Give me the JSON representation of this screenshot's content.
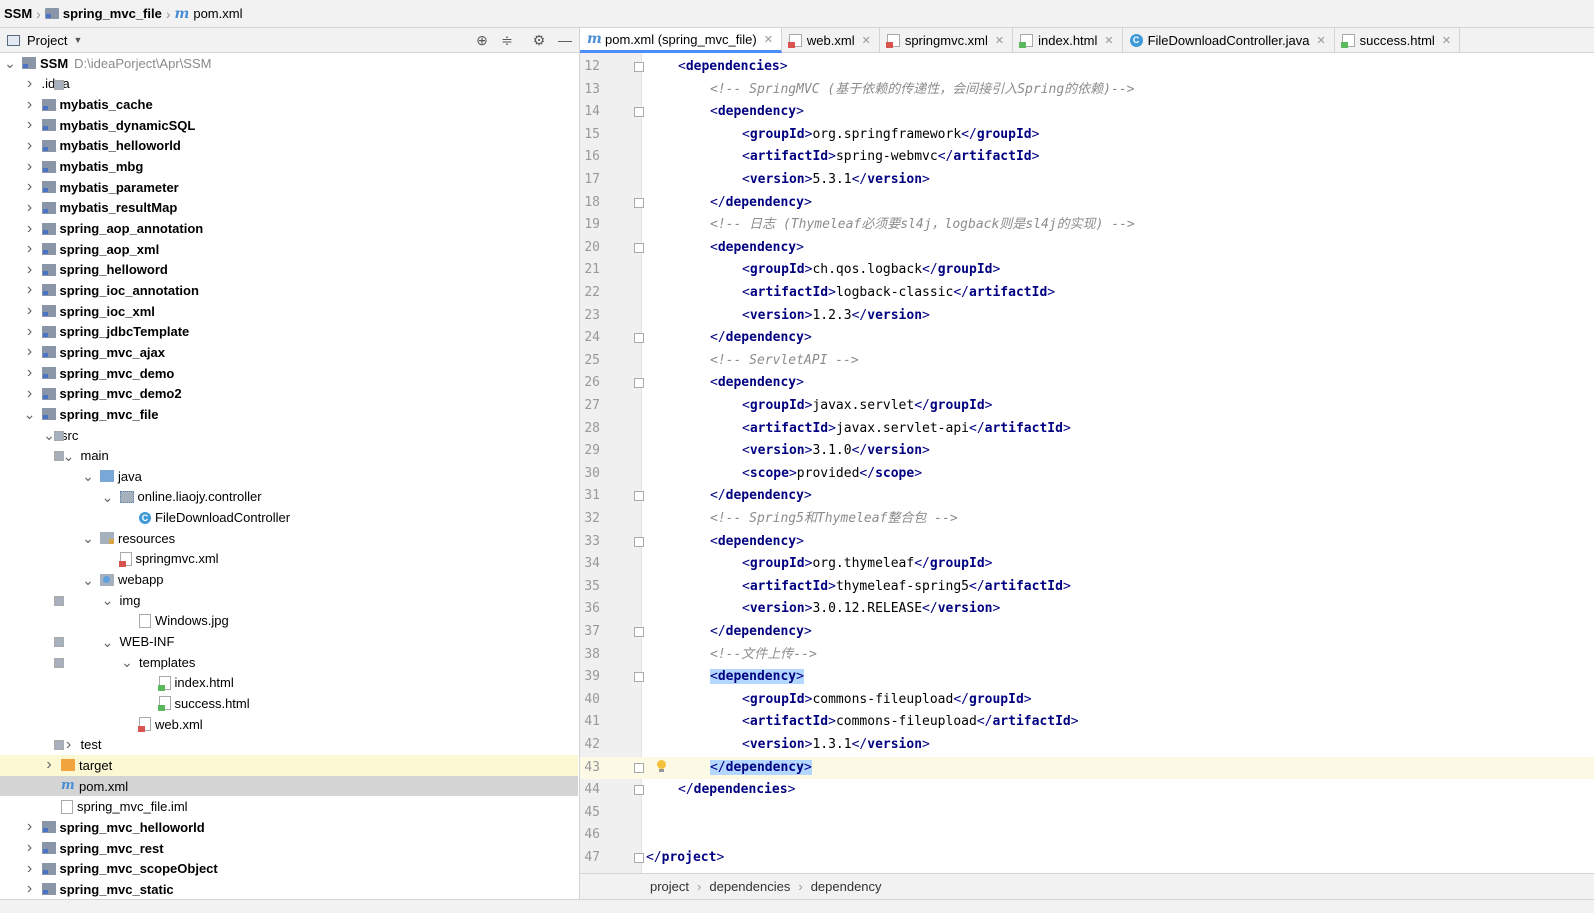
{
  "breadcrumb": {
    "items": [
      "SSM",
      "spring_mvc_file",
      "pom.xml"
    ]
  },
  "project_panel": {
    "title": "Project"
  },
  "tree": [
    {
      "depth": 0,
      "arrow": "open",
      "icon": "mod",
      "name": "SSM",
      "bold": true,
      "path": "D:\\ideaPorject\\Apr\\SSM"
    },
    {
      "depth": 1,
      "arrow": "closed",
      "icon": "fold",
      "name": ".idea",
      "bold": false
    },
    {
      "depth": 1,
      "arrow": "closed",
      "icon": "mod",
      "name": "mybatis_cache",
      "bold": true
    },
    {
      "depth": 1,
      "arrow": "closed",
      "icon": "mod",
      "name": "mybatis_dynamicSQL",
      "bold": true
    },
    {
      "depth": 1,
      "arrow": "closed",
      "icon": "mod",
      "name": "mybatis_helloworld",
      "bold": true
    },
    {
      "depth": 1,
      "arrow": "closed",
      "icon": "mod",
      "name": "mybatis_mbg",
      "bold": true
    },
    {
      "depth": 1,
      "arrow": "closed",
      "icon": "mod",
      "name": "mybatis_parameter",
      "bold": true
    },
    {
      "depth": 1,
      "arrow": "closed",
      "icon": "mod",
      "name": "mybatis_resultMap",
      "bold": true
    },
    {
      "depth": 1,
      "arrow": "closed",
      "icon": "mod",
      "name": "spring_aop_annotation",
      "bold": true
    },
    {
      "depth": 1,
      "arrow": "closed",
      "icon": "mod",
      "name": "spring_aop_xml",
      "bold": true
    },
    {
      "depth": 1,
      "arrow": "closed",
      "icon": "mod",
      "name": "spring_helloword",
      "bold": true
    },
    {
      "depth": 1,
      "arrow": "closed",
      "icon": "mod",
      "name": "spring_ioc_annotation",
      "bold": true
    },
    {
      "depth": 1,
      "arrow": "closed",
      "icon": "mod",
      "name": "spring_ioc_xml",
      "bold": true
    },
    {
      "depth": 1,
      "arrow": "closed",
      "icon": "mod",
      "name": "spring_jdbcTemplate",
      "bold": true
    },
    {
      "depth": 1,
      "arrow": "closed",
      "icon": "mod",
      "name": "spring_mvc_ajax",
      "bold": true
    },
    {
      "depth": 1,
      "arrow": "closed",
      "icon": "mod",
      "name": "spring_mvc_demo",
      "bold": true
    },
    {
      "depth": 1,
      "arrow": "closed",
      "icon": "mod",
      "name": "spring_mvc_demo2",
      "bold": true
    },
    {
      "depth": 1,
      "arrow": "open",
      "icon": "mod",
      "name": "spring_mvc_file",
      "bold": true
    },
    {
      "depth": 2,
      "arrow": "open",
      "icon": "fold",
      "name": "src",
      "bold": false
    },
    {
      "depth": 3,
      "arrow": "open",
      "icon": "fold",
      "name": "main",
      "bold": false
    },
    {
      "depth": 4,
      "arrow": "open",
      "icon": "src",
      "name": "java",
      "bold": false
    },
    {
      "depth": 5,
      "arrow": "open",
      "icon": "pkg",
      "name": "online.liaojy.controller",
      "bold": false
    },
    {
      "depth": 6,
      "arrow": "none",
      "icon": "cls",
      "name": "FileDownloadController",
      "bold": false
    },
    {
      "depth": 4,
      "arrow": "open",
      "icon": "res",
      "name": "resources",
      "bold": false
    },
    {
      "depth": 5,
      "arrow": "none",
      "icon": "xml",
      "name": "springmvc.xml",
      "bold": false
    },
    {
      "depth": 4,
      "arrow": "open",
      "icon": "web",
      "name": "webapp",
      "bold": false
    },
    {
      "depth": 5,
      "arrow": "open",
      "icon": "fold",
      "name": "img",
      "bold": false
    },
    {
      "depth": 6,
      "arrow": "none",
      "icon": "img",
      "name": "Windows.jpg",
      "bold": false
    },
    {
      "depth": 5,
      "arrow": "open",
      "icon": "fold",
      "name": "WEB-INF",
      "bold": false
    },
    {
      "depth": 6,
      "arrow": "open",
      "icon": "fold",
      "name": "templates",
      "bold": false
    },
    {
      "depth": 7,
      "arrow": "none",
      "icon": "html",
      "name": "index.html",
      "bold": false
    },
    {
      "depth": 7,
      "arrow": "none",
      "icon": "html",
      "name": "success.html",
      "bold": false
    },
    {
      "depth": 6,
      "arrow": "none",
      "icon": "xml",
      "name": "web.xml",
      "bold": false
    },
    {
      "depth": 3,
      "arrow": "closed",
      "icon": "fold",
      "name": "test",
      "bold": false
    },
    {
      "depth": 2,
      "arrow": "closed",
      "icon": "tgt",
      "name": "target",
      "bold": false,
      "state": "highlight"
    },
    {
      "depth": 2,
      "arrow": "none",
      "icon": "pom",
      "name": "pom.xml",
      "bold": false,
      "state": "selected"
    },
    {
      "depth": 2,
      "arrow": "none",
      "icon": "iml",
      "name": "spring_mvc_file.iml",
      "bold": false
    },
    {
      "depth": 1,
      "arrow": "closed",
      "icon": "mod",
      "name": "spring_mvc_helloworld",
      "bold": true
    },
    {
      "depth": 1,
      "arrow": "closed",
      "icon": "mod",
      "name": "spring_mvc_rest",
      "bold": true
    },
    {
      "depth": 1,
      "arrow": "closed",
      "icon": "mod",
      "name": "spring_mvc_scopeObject",
      "bold": true
    },
    {
      "depth": 1,
      "arrow": "closed",
      "icon": "mod",
      "name": "spring_mvc_static",
      "bold": true
    }
  ],
  "tabs": [
    {
      "label": "pom.xml (spring_mvc_file)",
      "icon": "pom",
      "active": true
    },
    {
      "label": "web.xml",
      "icon": "xml",
      "active": false
    },
    {
      "label": "springmvc.xml",
      "icon": "xml",
      "active": false
    },
    {
      "label": "index.html",
      "icon": "html",
      "active": false
    },
    {
      "label": "FileDownloadController.java",
      "icon": "cls",
      "active": false
    },
    {
      "label": "success.html",
      "icon": "html",
      "active": false
    }
  ],
  "code_lines": [
    {
      "n": "12",
      "indent": 1,
      "kind": "open",
      "tag": "dependencies",
      "fold": true
    },
    {
      "n": "13",
      "indent": 2,
      "kind": "comment",
      "text": "<!-- SpringMVC (基于依赖的传递性，会间接引入Spring的依赖)-->"
    },
    {
      "n": "14",
      "indent": 2,
      "kind": "open",
      "tag": "dependency",
      "fold": true
    },
    {
      "n": "15",
      "indent": 3,
      "kind": "elem",
      "tag": "groupId",
      "value": "org.springframework"
    },
    {
      "n": "16",
      "indent": 3,
      "kind": "elem",
      "tag": "artifactId",
      "value": "spring-webmvc"
    },
    {
      "n": "17",
      "indent": 3,
      "kind": "elem",
      "tag": "version",
      "value": "5.3.1"
    },
    {
      "n": "18",
      "indent": 2,
      "kind": "close",
      "tag": "dependency",
      "fold": true
    },
    {
      "n": "19",
      "indent": 2,
      "kind": "comment",
      "text": "<!-- 日志 (Thymeleaf必须要sl4j，logback则是sl4j的实现) -->"
    },
    {
      "n": "20",
      "indent": 2,
      "kind": "open",
      "tag": "dependency",
      "fold": true
    },
    {
      "n": "21",
      "indent": 3,
      "kind": "elem",
      "tag": "groupId",
      "value": "ch.qos.logback"
    },
    {
      "n": "22",
      "indent": 3,
      "kind": "elem",
      "tag": "artifactId",
      "value": "logback-classic"
    },
    {
      "n": "23",
      "indent": 3,
      "kind": "elem",
      "tag": "version",
      "value": "1.2.3"
    },
    {
      "n": "24",
      "indent": 2,
      "kind": "close",
      "tag": "dependency",
      "fold": true
    },
    {
      "n": "25",
      "indent": 2,
      "kind": "comment",
      "text": "<!-- ServletAPI -->"
    },
    {
      "n": "26",
      "indent": 2,
      "kind": "open",
      "tag": "dependency",
      "fold": true
    },
    {
      "n": "27",
      "indent": 3,
      "kind": "elem",
      "tag": "groupId",
      "value": "javax.servlet"
    },
    {
      "n": "28",
      "indent": 3,
      "kind": "elem",
      "tag": "artifactId",
      "value": "javax.servlet-api"
    },
    {
      "n": "29",
      "indent": 3,
      "kind": "elem",
      "tag": "version",
      "value": "3.1.0"
    },
    {
      "n": "30",
      "indent": 3,
      "kind": "elem",
      "tag": "scope",
      "value": "provided"
    },
    {
      "n": "31",
      "indent": 2,
      "kind": "close",
      "tag": "dependency",
      "fold": true
    },
    {
      "n": "32",
      "indent": 2,
      "kind": "comment",
      "text": "<!-- Spring5和Thymeleaf整合包 -->"
    },
    {
      "n": "33",
      "indent": 2,
      "kind": "open",
      "tag": "dependency",
      "fold": true
    },
    {
      "n": "34",
      "indent": 3,
      "kind": "elem",
      "tag": "groupId",
      "value": "org.thymeleaf"
    },
    {
      "n": "35",
      "indent": 3,
      "kind": "elem",
      "tag": "artifactId",
      "value": "thymeleaf-spring5"
    },
    {
      "n": "36",
      "indent": 3,
      "kind": "elem",
      "tag": "version",
      "value": "3.0.12.RELEASE"
    },
    {
      "n": "37",
      "indent": 2,
      "kind": "close",
      "tag": "dependency",
      "fold": true
    },
    {
      "n": "38",
      "indent": 2,
      "kind": "comment",
      "text": "<!--文件上传-->"
    },
    {
      "n": "39",
      "indent": 2,
      "kind": "open",
      "tag": "dependency",
      "fold": true,
      "highlight": true
    },
    {
      "n": "40",
      "indent": 3,
      "kind": "elem",
      "tag": "groupId",
      "value": "commons-fileupload"
    },
    {
      "n": "41",
      "indent": 3,
      "kind": "elem",
      "tag": "artifactId",
      "value": "commons-fileupload"
    },
    {
      "n": "42",
      "indent": 3,
      "kind": "elem",
      "tag": "version",
      "value": "1.3.1"
    },
    {
      "n": "43",
      "indent": 2,
      "kind": "close",
      "tag": "dependency",
      "fold": true,
      "highlight": true,
      "current": true,
      "bulb": true
    },
    {
      "n": "44",
      "indent": 1,
      "kind": "close",
      "tag": "dependencies",
      "fold": true
    },
    {
      "n": "45",
      "indent": 0,
      "kind": "blank"
    },
    {
      "n": "46",
      "indent": 0,
      "kind": "blank"
    },
    {
      "n": "47",
      "indent": 0,
      "kind": "close",
      "tag": "project",
      "fold": true
    }
  ],
  "status_breadcrumb": [
    "project",
    "dependencies",
    "dependency"
  ]
}
